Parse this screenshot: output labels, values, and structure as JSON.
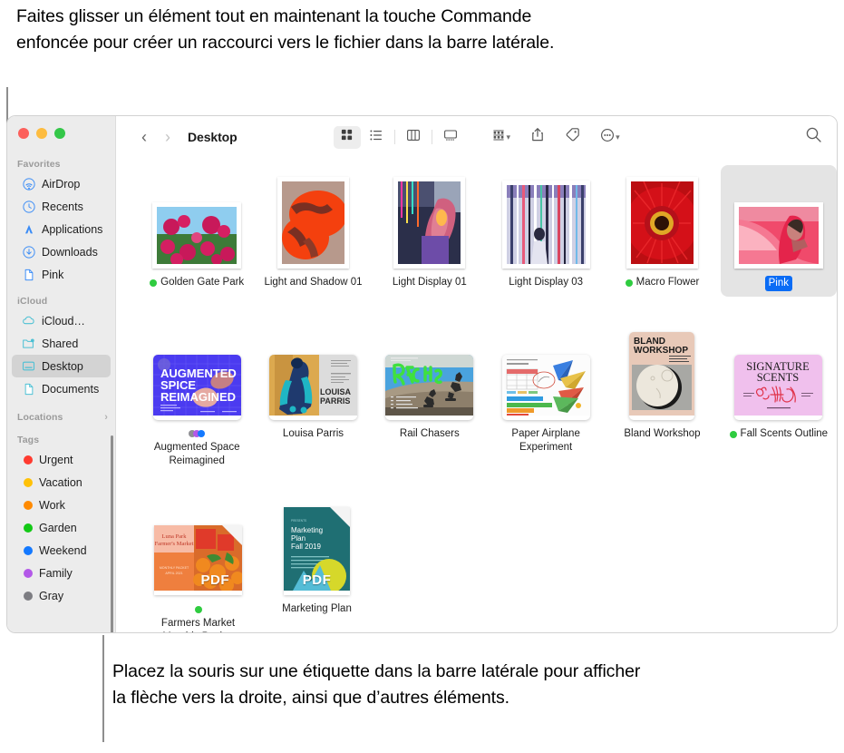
{
  "callouts": {
    "top": "Faites glisser un élément tout en maintenant la touche Commande enfoncée pour créer un raccourci vers le fichier dans la barre latérale.",
    "bottom": "Placez la souris sur une étiquette dans la barre latérale pour afficher la flèche vers la droite, ainsi que d’autres éléments."
  },
  "window": {
    "traffic_lights": [
      "close",
      "minimize",
      "zoom"
    ],
    "accent_blue": "#0a6cf5",
    "sidebar_bg": "#ececec",
    "selected_row_bg": "#d3d3d3"
  },
  "toolbar": {
    "back_label": "‹",
    "forward_label": "›",
    "title": "Desktop",
    "view_buttons": [
      {
        "name": "icon-view",
        "icon": "grid-icon",
        "active": true
      },
      {
        "name": "list-view",
        "icon": "list-icon",
        "active": false
      },
      {
        "name": "column-view",
        "icon": "columns-icon",
        "active": false
      },
      {
        "name": "gallery-view",
        "icon": "gallery-icon",
        "active": false
      }
    ],
    "right_buttons": [
      {
        "name": "group-by",
        "icon": "group-icon",
        "caret": true
      },
      {
        "name": "share",
        "icon": "share-icon",
        "caret": false
      },
      {
        "name": "tags",
        "icon": "tag-icon",
        "caret": false
      },
      {
        "name": "more-actions",
        "icon": "ellipsis-circle-icon",
        "caret": true
      }
    ],
    "search": {
      "icon": "search-icon",
      "placeholder": "Rechercher"
    }
  },
  "sidebar": {
    "sections": [
      {
        "title": "Favorites",
        "items": [
          {
            "label": "AirDrop",
            "icon": "airdrop-icon",
            "selected": false
          },
          {
            "label": "Recents",
            "icon": "clock-icon",
            "selected": false
          },
          {
            "label": "Applications",
            "icon": "applications-icon",
            "selected": false
          },
          {
            "label": "Downloads",
            "icon": "downloads-icon",
            "selected": false
          },
          {
            "label": "Pink",
            "icon": "document-icon",
            "selected": false
          }
        ]
      },
      {
        "title": "iCloud",
        "items": [
          {
            "label": "iCloud…",
            "icon": "cloud-icon",
            "selected": false
          },
          {
            "label": "Shared",
            "icon": "shared-folder-icon",
            "selected": false
          },
          {
            "label": "Desktop",
            "icon": "desktop-icon",
            "selected": true
          },
          {
            "label": "Documents",
            "icon": "document-icon",
            "selected": false
          }
        ]
      },
      {
        "title": "Locations",
        "disclosure": "›",
        "items": []
      },
      {
        "title": "Tags",
        "items": [
          {
            "label": "Urgent",
            "icon": "tag-dot",
            "color": "#ff3b30"
          },
          {
            "label": "Vacation",
            "icon": "tag-dot",
            "color": "#ffc107"
          },
          {
            "label": "Work",
            "icon": "tag-dot",
            "color": "#ff8a00"
          },
          {
            "label": "Garden",
            "icon": "tag-dot",
            "color": "#13c916"
          },
          {
            "label": "Weekend",
            "icon": "tag-dot",
            "color": "#1479ff"
          },
          {
            "label": "Family",
            "icon": "tag-dot",
            "color": "#b358e8"
          },
          {
            "label": "Gray",
            "icon": "tag-dot",
            "color": "#7d7d82"
          }
        ]
      }
    ]
  },
  "files": {
    "rows": [
      [
        {
          "name": "Golden Gate Park",
          "kind": "photo",
          "tag": "#2fcc40",
          "selected": false
        },
        {
          "name": "Light and Shadow 01",
          "kind": "photo",
          "tag": null,
          "selected": false
        },
        {
          "name": "Light Display 01",
          "kind": "photo",
          "tag": null,
          "selected": false
        },
        {
          "name": "Light Display 03",
          "kind": "photo",
          "tag": null,
          "selected": false
        },
        {
          "name": "Macro Flower",
          "kind": "photo",
          "tag": "#2fcc40",
          "selected": false
        },
        {
          "name": "Pink",
          "kind": "photo",
          "tag": null,
          "selected": true
        }
      ],
      [
        {
          "name": "Augmented Space Reimagined",
          "kind": "card",
          "tags": [
            "#8e8e93",
            "#b358e8",
            "#1479ff"
          ],
          "selected": false
        },
        {
          "name": "Louisa Parris",
          "kind": "card",
          "tag": null,
          "selected": false
        },
        {
          "name": "Rail Chasers",
          "kind": "card",
          "tag": null,
          "selected": false
        },
        {
          "name": "Paper Airplane Experiment",
          "kind": "card",
          "tag": null,
          "selected": false
        },
        {
          "name": "Bland Workshop",
          "kind": "card",
          "tag": null,
          "selected": false
        },
        {
          "name": "Fall Scents Outline",
          "kind": "card",
          "tag": "#2fcc40",
          "selected": false
        }
      ],
      [
        {
          "name": "Farmers Market Monthly Packet",
          "kind": "pdf",
          "badge": "PDF",
          "tag": "#2fcc40",
          "selected": false
        },
        {
          "name": "Marketing Plan",
          "kind": "pdf",
          "badge": "PDF",
          "tag": null,
          "selected": false
        }
      ]
    ]
  }
}
